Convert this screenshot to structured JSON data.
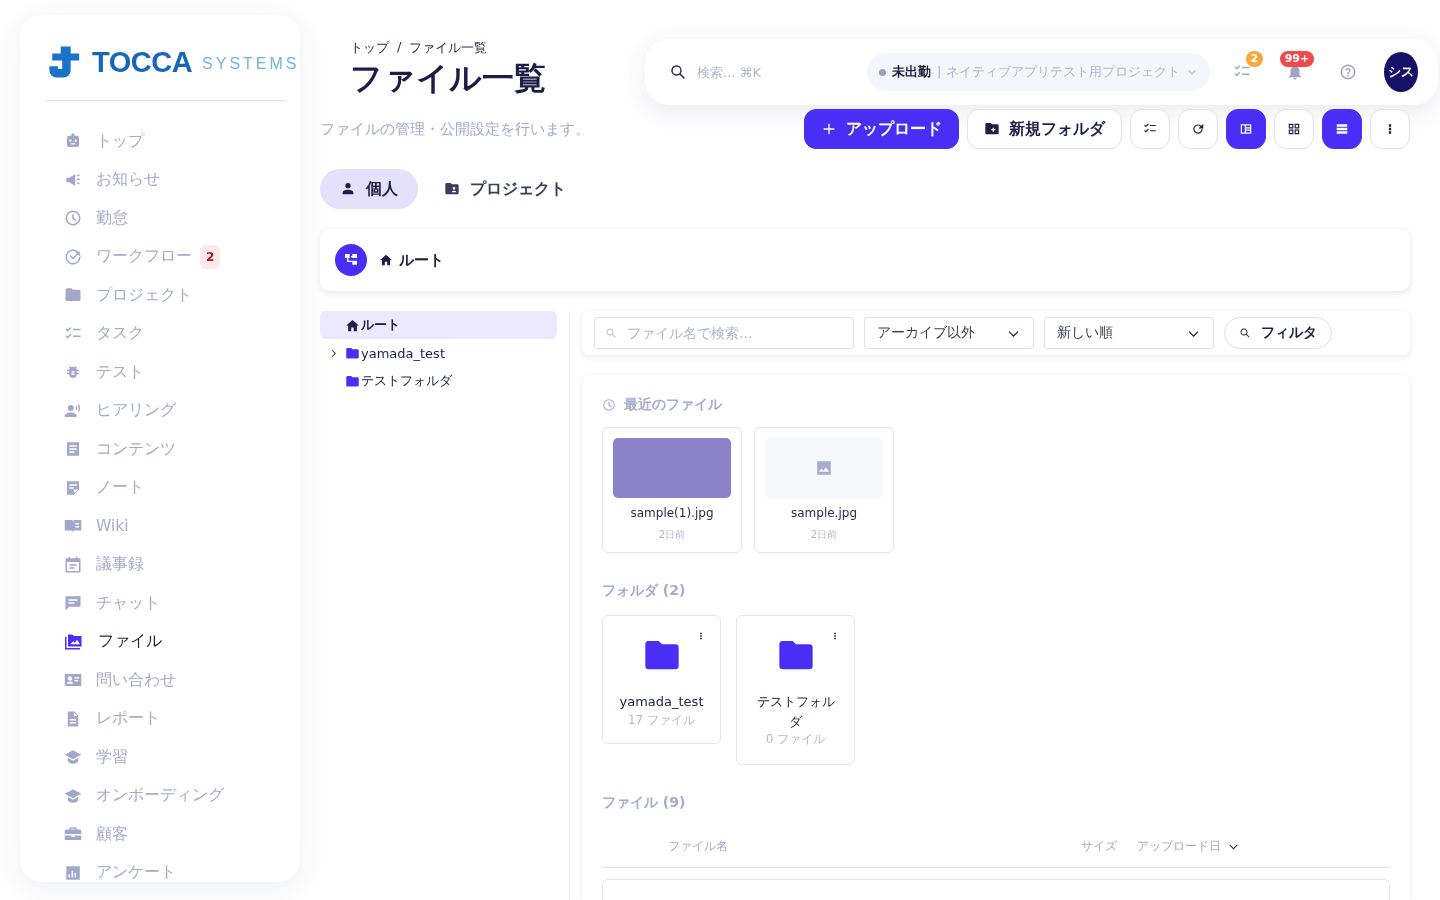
{
  "logo": {
    "name": "TOCCA",
    "suffix": "SYSTEMS"
  },
  "sidebar": {
    "items": [
      {
        "label": "トップ",
        "selected": false
      },
      {
        "label": "お知らせ",
        "selected": false
      },
      {
        "label": "勤怠",
        "selected": false
      },
      {
        "label": "ワークフロー",
        "selected": false,
        "badge": "2"
      },
      {
        "label": "プロジェクト",
        "selected": false
      },
      {
        "label": "タスク",
        "selected": false
      },
      {
        "label": "テスト",
        "selected": false
      },
      {
        "label": "ヒアリング",
        "selected": false
      },
      {
        "label": "コンテンツ",
        "selected": false
      },
      {
        "label": "ノート",
        "selected": false
      },
      {
        "label": "Wiki",
        "selected": false
      },
      {
        "label": "議事録",
        "selected": false
      },
      {
        "label": "チャット",
        "selected": false
      },
      {
        "label": "ファイル",
        "selected": true
      },
      {
        "label": "問い合わせ",
        "selected": false
      },
      {
        "label": "レポート",
        "selected": false
      },
      {
        "label": "学習",
        "selected": false
      },
      {
        "label": "オンボーディング",
        "selected": false
      },
      {
        "label": "顧客",
        "selected": false
      },
      {
        "label": "アンケート",
        "selected": false
      }
    ]
  },
  "breadcrumb": [
    "トップ",
    "ファイル一覧"
  ],
  "breadcrumb_separator": "/",
  "page_title": "ファイル一覧",
  "subtitle": "ファイルの管理・公開設定を行います。",
  "top_bar": {
    "search": {
      "placeholder": "検索... ⌘K"
    },
    "status": {
      "label": "未出勤",
      "project": "| ネイティブアプリテスト用プロジェクト"
    },
    "task_badge": "2",
    "notification_badge": "99+",
    "avatar": "シス"
  },
  "toolbar": {
    "upload": "アップロード",
    "new_folder": "新規フォルダ",
    "view_buttons": [
      {
        "kind": "checklist",
        "selected": false
      },
      {
        "kind": "refresh",
        "selected": false
      },
      {
        "kind": "split",
        "selected": true
      },
      {
        "kind": "grid",
        "selected": false
      },
      {
        "kind": "list",
        "selected": true
      },
      {
        "kind": "more",
        "selected": false
      }
    ]
  },
  "scope_tabs": [
    {
      "label": "個人",
      "selected": true
    },
    {
      "label": "プロジェクト",
      "selected": false
    }
  ],
  "path_bar": {
    "label": "ルート"
  },
  "tree": [
    {
      "label": "ルート",
      "kind": "home",
      "selected": true,
      "expandable": false
    },
    {
      "label": "yamada_test",
      "kind": "folder",
      "selected": false,
      "expandable": true
    },
    {
      "label": "テストフォルダ",
      "kind": "folder",
      "selected": false,
      "expandable": false
    }
  ],
  "filters": {
    "search": {
      "placeholder": "ファイル名で検索..."
    },
    "archive_select": "アーカイブ以外",
    "sort_select": "新しい順",
    "filter_button": "フィルタ"
  },
  "recent": {
    "title": "最近のファイル",
    "files": [
      {
        "name": "sample(1).jpg",
        "time": "2日前",
        "kind": "photo"
      },
      {
        "name": "sample.jpg",
        "time": "2日前",
        "kind": "placeholder"
      }
    ]
  },
  "folders": {
    "title": "フォルダ (2)",
    "items": [
      {
        "name": "yamada_test",
        "count": "17 ファイル"
      },
      {
        "name": "テストフォルダ",
        "count": "0 ファイル"
      }
    ]
  },
  "files": {
    "title": "ファイル (9)",
    "columns": [
      {
        "label": "ファイル名",
        "sorted": false
      },
      {
        "label": "サイズ",
        "sorted": false
      },
      {
        "label": "アップロード日",
        "sorted": true
      }
    ]
  }
}
